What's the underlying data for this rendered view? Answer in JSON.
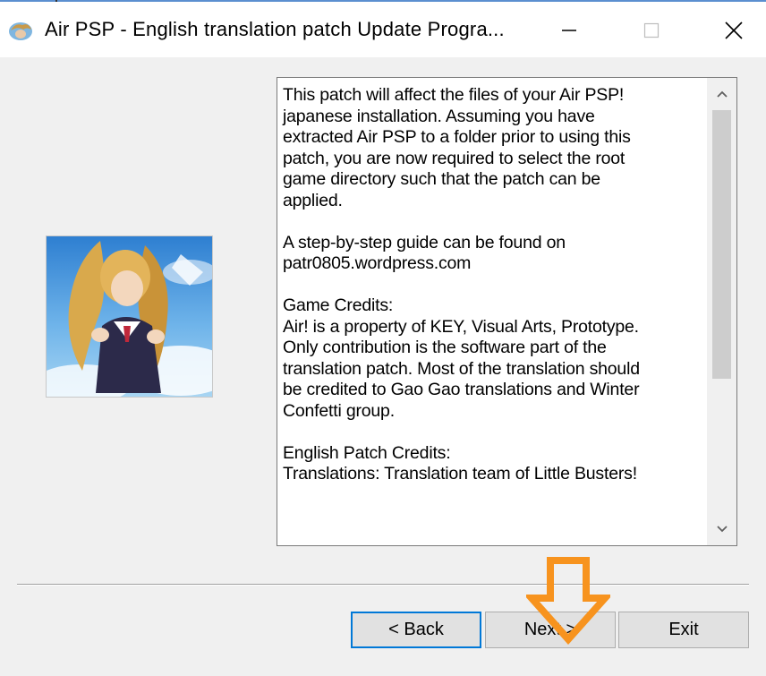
{
  "window": {
    "title": "Air PSP - English translation patch Update Progra...",
    "controls": [
      "minimize",
      "maximize",
      "close"
    ]
  },
  "description": {
    "text": "This patch will affect the files of your Air PSP!\njapanese installation. Assuming you have\nextracted Air PSP to a folder prior to using this\npatch, you are now required to select the root\ngame directory such that the patch can be\napplied.\n\nA step-by-step guide can be found on\npatr0805.wordpress.com\n\nGame Credits:\nAir! is a property of KEY, Visual Arts, Prototype.\nOnly contribution is the software part of the\ntranslation patch. Most of the translation should\nbe credited to Gao Gao translations and Winter\nConfetti group.\n\nEnglish Patch Credits:\nTranslations: Translation team of Little Busters!"
  },
  "buttons": {
    "back": "< Back",
    "next": "Next >",
    "exit": "Exit"
  },
  "colors": {
    "focus_border": "#0078d7",
    "arrow": "#f7931e",
    "dialog_bg": "#f0f0f0"
  },
  "icons": {
    "app": "app-icon",
    "scroll_up": "chevron-up-icon",
    "scroll_down": "chevron-down-icon",
    "annotation": "arrow-down-icon"
  }
}
